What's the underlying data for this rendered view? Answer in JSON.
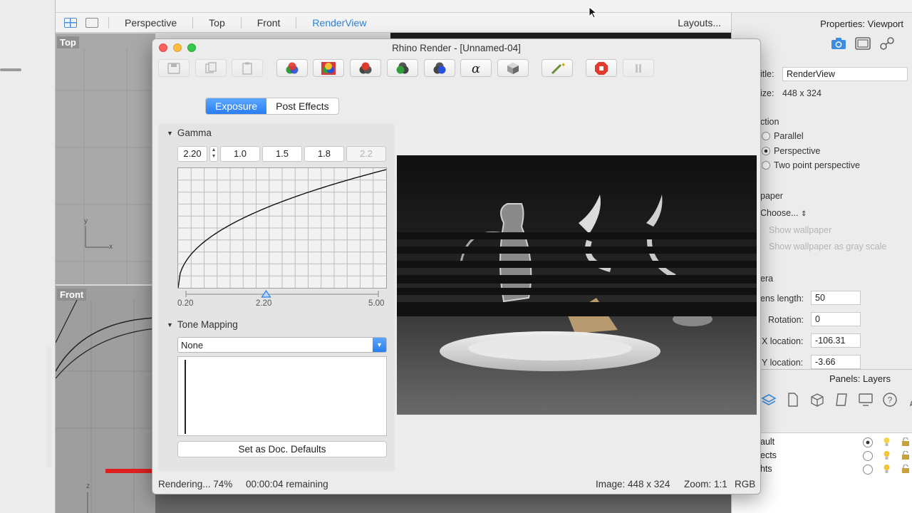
{
  "viewport_tabs": {
    "tabs": [
      "Perspective",
      "Top",
      "Front",
      "RenderView"
    ],
    "active": "RenderView",
    "layouts_label": "Layouts..."
  },
  "viewports": {
    "top_label": "Top",
    "front_label": "Front",
    "axis_y": "y",
    "axis_x": "x",
    "axis_z": "z"
  },
  "properties": {
    "title": "Properties: Viewport",
    "title_label": "itle:",
    "title_value": "RenderView",
    "size_label": "ize:",
    "size_value": "448 x 324",
    "projection_header": "ction",
    "projections": [
      "Parallel",
      "Perspective",
      "Two point perspective"
    ],
    "projection_selected": "Perspective",
    "wallpaper_header": "paper",
    "wallpaper_choose": "Choose...",
    "show_wallpaper": "Show wallpaper",
    "show_wallpaper_gray": "Show wallpaper as gray scale",
    "camera_header": "era",
    "lens_label": "ens length:",
    "lens_value": "50",
    "rotation_label": "Rotation:",
    "rotation_value": "0",
    "xloc_label": "X location:",
    "xloc_value": "-106.31",
    "yloc_label": "Y location:",
    "yloc_value": "-3.66"
  },
  "layers": {
    "title": "Panels: Layers",
    "rows": [
      {
        "name": "ault",
        "current": true
      },
      {
        "name": "ects",
        "current": false
      },
      {
        "name": "hts",
        "current": false
      }
    ]
  },
  "render_window": {
    "title": "Rhino Render - [Unnamed-04]",
    "segments": [
      "Exposure",
      "Post Effects"
    ],
    "active_segment": "Exposure",
    "gamma_title": "Gamma",
    "gamma_value": "2.20",
    "gamma_presets": [
      "1.0",
      "1.5",
      "1.8",
      "2.2"
    ],
    "gamma_min": "0.20",
    "gamma_current": "2.20",
    "gamma_max": "5.00",
    "gamma_slider_value": 2.2,
    "tone_title": "Tone Mapping",
    "tone_value": "None",
    "defaults_button": "Set as Doc. Defaults",
    "status_text": "Rendering... 74%",
    "progress": 0.74,
    "time_remaining": "00:00:04 remaining",
    "image_size": "Image: 448 x 324",
    "zoom": "Zoom: 1:1",
    "channel": "RGB"
  },
  "toolbar_icons": [
    "save-icon",
    "copy-icon",
    "paste-icon",
    "rgb-channels-icon",
    "color-channels-icon",
    "red-channel-icon",
    "green-channel-icon",
    "blue-channel-icon",
    "alpha-icon",
    "shading-icon",
    "magic-wand-icon",
    "stop-icon",
    "pause-icon"
  ],
  "colors": {
    "accent": "#2a7ef0",
    "stop": "#e03a2f"
  }
}
